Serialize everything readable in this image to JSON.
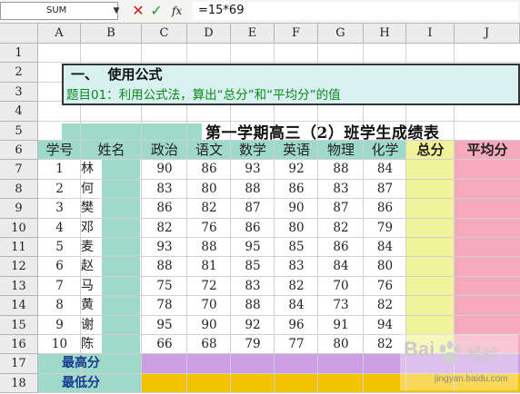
{
  "formula_bar": {
    "name_box": "SUM",
    "formula": "=15*69",
    "cancel_symbol": "✕",
    "enter_symbol": "✓",
    "fx_symbol": "fx"
  },
  "columns": [
    "A",
    "B",
    "C",
    "D",
    "E",
    "F",
    "G",
    "H",
    "I",
    "J"
  ],
  "rows": [
    "1",
    "2",
    "3",
    "4",
    "5",
    "6",
    "7",
    "8",
    "9",
    "10",
    "11",
    "12",
    "13",
    "14",
    "15",
    "16",
    "17",
    "18"
  ],
  "info": {
    "title": "一、  使用公式",
    "desc": "题目01：利用公式法，算出“总分”和“平均分”的值"
  },
  "table_title": "第一学期高三（2）班学生成绩表",
  "headers": [
    "学号",
    "姓名",
    "政治",
    "语文",
    "数学",
    "英语",
    "物理",
    "化学",
    "总分",
    "平均分"
  ],
  "students": [
    {
      "id": "1",
      "name": "林",
      "scores": [
        "90",
        "86",
        "93",
        "92",
        "88",
        "84"
      ]
    },
    {
      "id": "2",
      "name": "何",
      "scores": [
        "83",
        "80",
        "88",
        "86",
        "83",
        "87"
      ]
    },
    {
      "id": "3",
      "name": "樊",
      "scores": [
        "86",
        "82",
        "87",
        "90",
        "87",
        "86"
      ]
    },
    {
      "id": "4",
      "name": "邓",
      "scores": [
        "82",
        "76",
        "86",
        "80",
        "82",
        "79"
      ]
    },
    {
      "id": "5",
      "name": "麦",
      "scores": [
        "93",
        "88",
        "95",
        "85",
        "86",
        "84"
      ]
    },
    {
      "id": "6",
      "name": "赵",
      "scores": [
        "88",
        "81",
        "85",
        "83",
        "84",
        "80"
      ]
    },
    {
      "id": "7",
      "name": "马",
      "scores": [
        "75",
        "72",
        "83",
        "82",
        "70",
        "76"
      ]
    },
    {
      "id": "8",
      "name": "黄",
      "scores": [
        "78",
        "70",
        "88",
        "84",
        "73",
        "82"
      ]
    },
    {
      "id": "9",
      "name": "谢",
      "scores": [
        "95",
        "90",
        "92",
        "96",
        "91",
        "94"
      ]
    },
    {
      "id": "10",
      "name": "陈",
      "scores": [
        "66",
        "68",
        "79",
        "77",
        "80",
        "82"
      ]
    }
  ],
  "summary": {
    "max_label": "最高分",
    "min_label": "最低分"
  },
  "watermark": {
    "brand": "Bai",
    "brand2": "经验",
    "url": "jingyan.baidu.com"
  },
  "colors": {
    "teal": "#9fd9c9",
    "yellow_col": "#f1f39a",
    "pink_col": "#f4a9bd",
    "purple_row": "#cc9ee3",
    "gold_row": "#f3c300",
    "info_bg": "#d9f0f0",
    "label_blue": "#163a8f",
    "desc_green": "#0a8a1a"
  }
}
